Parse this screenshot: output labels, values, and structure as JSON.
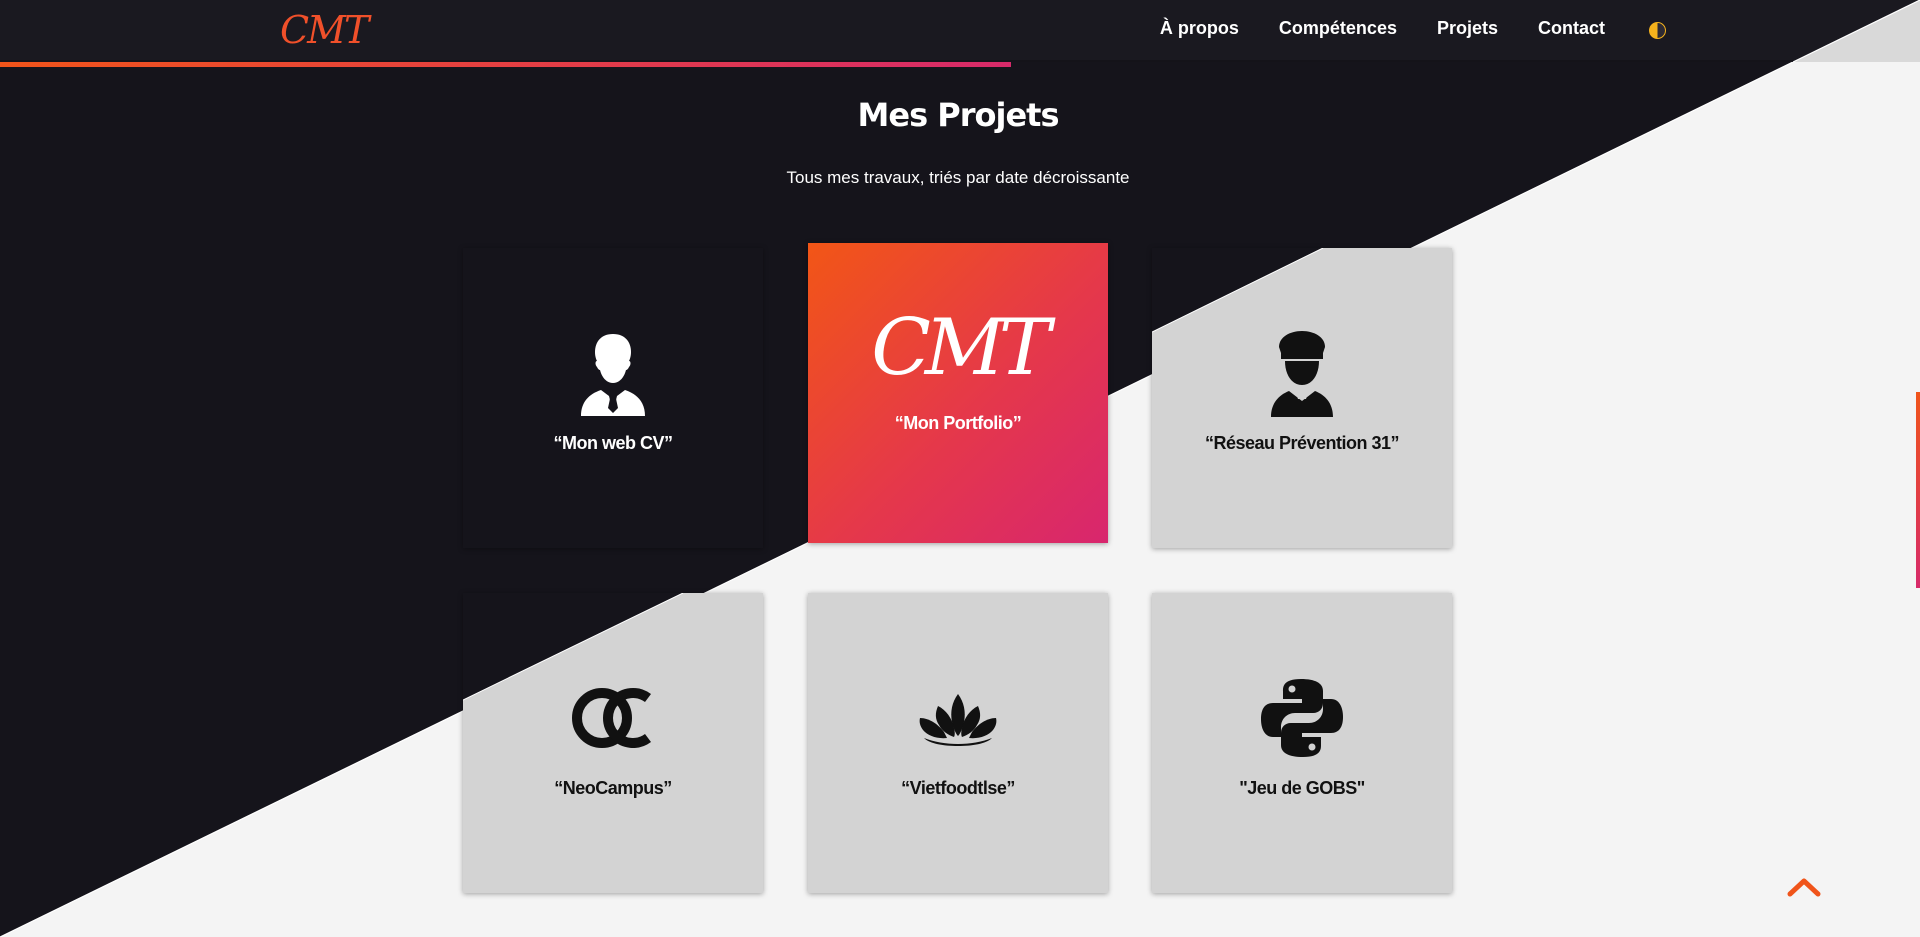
{
  "brand": {
    "logo": "CMT",
    "accent": "#f0502a",
    "dark": "#15141b",
    "light": "#f4f4f4",
    "card_light": "#d3d3d3"
  },
  "nav": {
    "items": [
      "À propos",
      "Compétences",
      "Projets",
      "Contact"
    ]
  },
  "scroll_progress": 0.52,
  "section": {
    "title": "Mes Projets",
    "subtitle": "Tous mes travaux, triés par date décroissante"
  },
  "projects": [
    {
      "title": "“Mon web CV”",
      "icon": "businessman-icon"
    },
    {
      "title": "“Mon Portfolio”",
      "icon": "cmt-logo"
    },
    {
      "title": "“Réseau Prévention 31”",
      "icon": "officer-icon"
    },
    {
      "title": "“NeoCampus”",
      "icon": "oc-logo-icon"
    },
    {
      "title": "“Vietfoodtlse”",
      "icon": "lotus-icon"
    },
    {
      "title": "\"Jeu de GOBS\"",
      "icon": "python-icon"
    }
  ]
}
